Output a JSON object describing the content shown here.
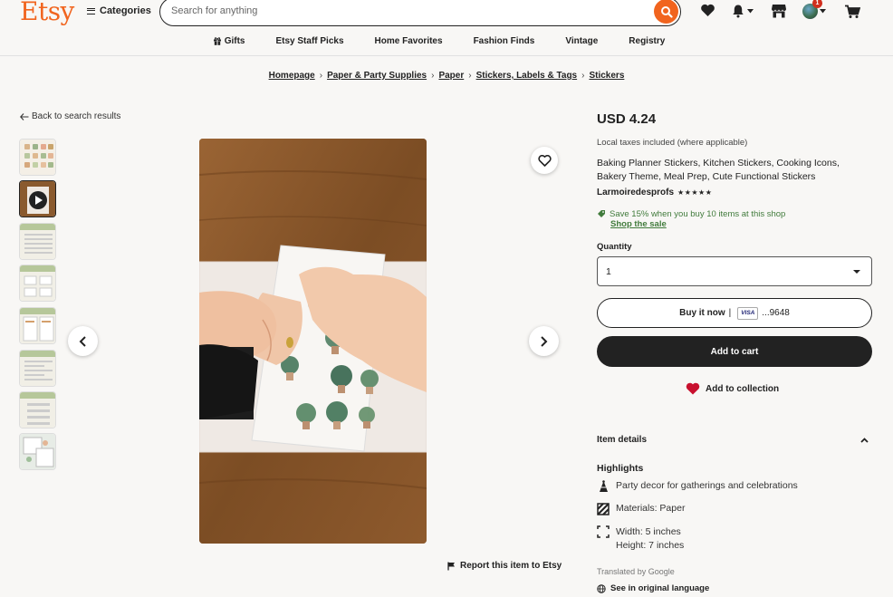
{
  "header": {
    "logo": "Etsy",
    "categories_label": "Categories",
    "search_placeholder": "Search for anything",
    "cart_badge": "1"
  },
  "nav": {
    "items": [
      "Gifts",
      "Etsy Staff Picks",
      "Home Favorites",
      "Fashion Finds",
      "Vintage",
      "Registry"
    ]
  },
  "breadcrumb": [
    "Homepage",
    "Paper & Party Supplies",
    "Paper",
    "Stickers, Labels & Tags",
    "Stickers"
  ],
  "back_link": "Back to search results",
  "report_label": "Report this item to Etsy",
  "listing": {
    "price": "USD 4.24",
    "taxes_note": "Local taxes included (where applicable)",
    "title": "Baking Planner Stickers, Kitchen Stickers, Cooking Icons, Bakery Theme, Meal Prep, Cute Functional Stickers",
    "shop_name": "Larmoiredesprofs",
    "rating_stars": "★★★★★",
    "sale_text": "Save 15% when you buy 10 items at this shop",
    "sale_link": "Shop the sale",
    "quantity_label": "Quantity",
    "quantity_value": "1",
    "buy_now_label": "Buy it now",
    "buy_now_sep": "|",
    "card_brand": "VISA",
    "card_digits": "...9648",
    "add_to_cart_label": "Add to cart",
    "add_to_collection_label": "Add to collection"
  },
  "item_details": {
    "header": "Item details",
    "highlights_label": "Highlights",
    "highlights": [
      {
        "icon": "party-icon",
        "text": "Party decor for gatherings and celebrations"
      },
      {
        "icon": "material-icon",
        "text": "Materials: Paper"
      },
      {
        "icon": "dimensions-icon",
        "text": "Width: 5 inches",
        "text2": "Height: 7 inches"
      }
    ],
    "translated_note": "Translated by Google",
    "original_language_link": "See in original language"
  },
  "colors": {
    "brand": "#f1641e",
    "sale_green": "#417b3c",
    "button_dark": "#222222",
    "heart_red": "#c8102e"
  }
}
